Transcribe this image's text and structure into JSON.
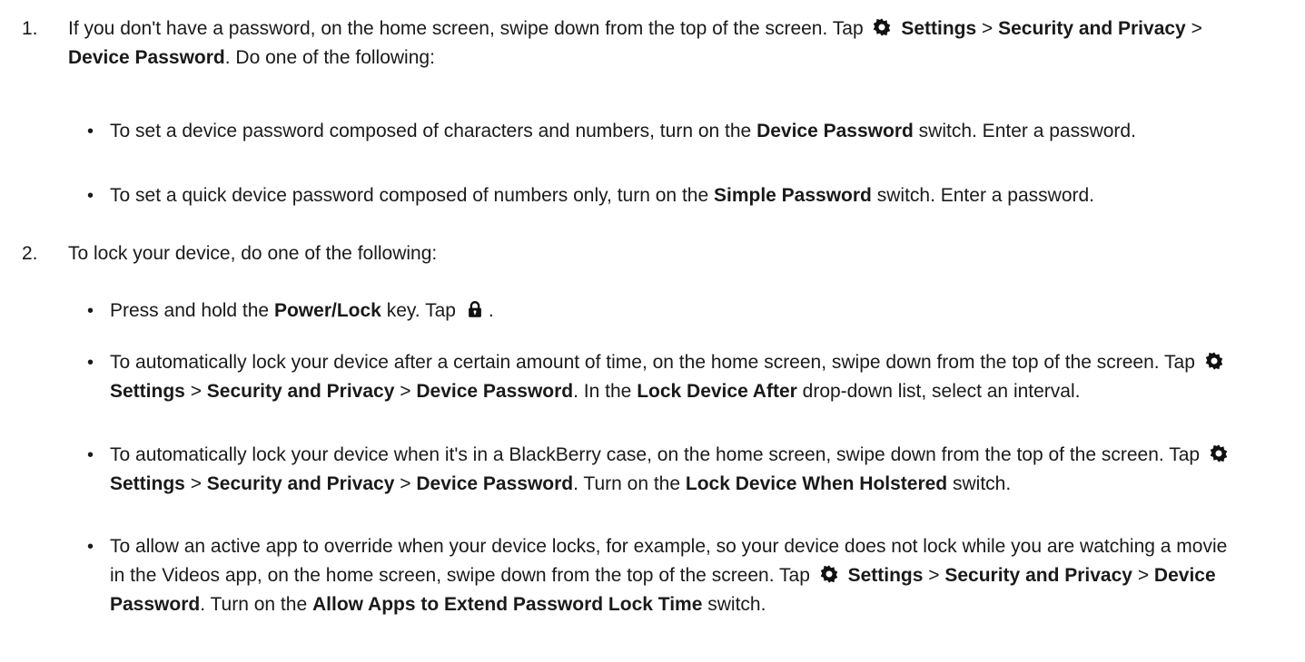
{
  "icons": {
    "settings": "gear-icon",
    "lock": "lock-icon"
  },
  "steps": [
    {
      "number": "1.",
      "t1": "If you don't have a password, on the home screen, swipe down from the top of the screen. Tap",
      "settings": "Settings",
      "sep": ">",
      "security": "Security and Privacy",
      "device_password": "Device Password",
      "t2": ". Do one of the following:",
      "bullets": [
        {
          "t1": "To set a device password composed of characters and numbers, turn on the",
          "b1": "Device Password",
          "t2": "switch. Enter a password."
        },
        {
          "t1": "To set a quick device password composed of numbers only, turn on the",
          "b1": "Simple Password",
          "t2": "switch. Enter a password."
        }
      ]
    },
    {
      "number": "2.",
      "t1": "To lock your device, do one of the following:",
      "bullets": [
        {
          "t1": "Press and hold the",
          "b1": "Power/Lock",
          "t2": "key. Tap",
          "t3": "."
        },
        {
          "t1": "To automatically lock your device after a certain amount of time, on the home screen, swipe down from the top of the screen. Tap",
          "settings": "Settings",
          "sep": ">",
          "security": "Security and Privacy",
          "device_password": "Device Password",
          "t2": ". In the",
          "b1": "Lock Device After",
          "t3": "drop-down list, select an interval."
        },
        {
          "t1": "To automatically lock your device when it's in a BlackBerry case, on the home screen, swipe down from the top of the screen. Tap",
          "settings": "Settings",
          "sep": ">",
          "security": "Security and Privacy",
          "device_password": "Device Password",
          "t2": ". Turn on the",
          "b1": "Lock Device When Holstered",
          "t3": "switch."
        },
        {
          "t1": "To allow an active app to override when your device locks, for example, so your device does not lock while you are watching a movie in the Videos app, on the home screen, swipe down from the top of the screen. Tap",
          "settings": "Settings",
          "sep": ">",
          "security": "Security and Privacy",
          "device_password": "Device Password",
          "t2": ". Turn on the",
          "b1": "Allow Apps to Extend Password Lock Time",
          "t3": "switch."
        }
      ]
    }
  ]
}
